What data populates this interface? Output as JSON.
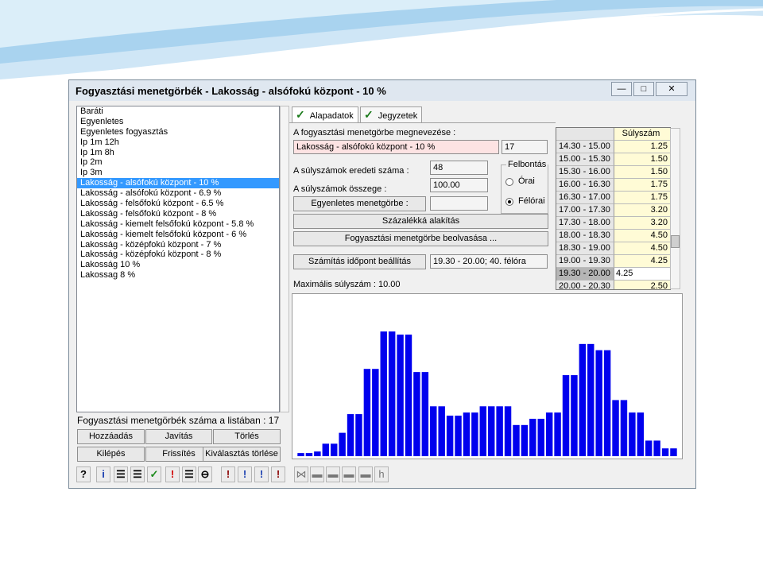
{
  "window": {
    "title": "Fogyasztási menetgörbék - Lakosság - alsófokú központ - 10 %",
    "minimize_glyph": "—",
    "maximize_glyph": "□",
    "close_glyph": "✕"
  },
  "list": {
    "items": [
      "Baráti",
      "Egyenletes",
      "Egyenletes fogyasztás",
      "Ip 1m 12h",
      "Ip 1m 8h",
      "Ip 2m",
      "Ip 3m",
      "Lakosság - alsófokú központ - 10 %",
      "Lakosság - alsófokú központ - 6.9 %",
      "Lakosság - felsőfokú központ - 6.5 %",
      "Lakosság - felsőfokú központ - 8 %",
      "Lakosság - kiemelt felsőfokú központ - 5.8 %",
      "Lakosság - kiemelt felsőfokú központ - 6 %",
      "Lakosság - középfokú központ - 7 %",
      "Lakosság - középfokú központ - 8 %",
      "Lakosság 10 %",
      "Lakossag 8 %"
    ],
    "selected_index": 7,
    "count_label": "Fogyasztási menetgörbék száma a listában : 17"
  },
  "buttons": {
    "add": "Hozzáadás",
    "edit": "Javítás",
    "delete": "Törlés",
    "exit": "Kilépés",
    "refresh": "Frissítés",
    "clear_selection": "Kiválasztás törlése",
    "uniform": "Egyenletes menetgörbe :",
    "percent": "Százalékká alakítás",
    "read": "Fogyasztási menetgörbe beolvasása ...",
    "calc_time": "Számítás időpont beállítás"
  },
  "tabs": [
    {
      "label": "Alapadatok",
      "check": "✓"
    },
    {
      "label": "Jegyzetek",
      "check": "✓"
    }
  ],
  "form": {
    "name_label": "A fogyasztási menetgörbe megnevezése :",
    "name_value": "Lakosság - alsófokú központ - 10 %",
    "name_id": "17",
    "orig_count_label": "A súlyszámok eredeti száma :",
    "orig_count_value": "48",
    "sum_label": "A súlyszámok összege :",
    "sum_value": "100.00",
    "uniform_value": "",
    "resolution_title": "Felbontás",
    "opt_hourly": "Órai",
    "opt_halfhourly": "Félórai",
    "calc_time_value": "19.30 - 20.00; 40. félóra",
    "max_label": "Maximális súlyszám : 10.00"
  },
  "grid": {
    "header": "Súlyszám",
    "rows": [
      {
        "time": "14.30 - 15.00",
        "value": "1.25"
      },
      {
        "time": "15.00 - 15.30",
        "value": "1.50"
      },
      {
        "time": "15.30 - 16.00",
        "value": "1.50"
      },
      {
        "time": "16.00 - 16.30",
        "value": "1.75"
      },
      {
        "time": "16.30 - 17.00",
        "value": "1.75"
      },
      {
        "time": "17.00 - 17.30",
        "value": "3.20"
      },
      {
        "time": "17.30 - 18.00",
        "value": "3.20"
      },
      {
        "time": "18.00 - 18.30",
        "value": "4.50"
      },
      {
        "time": "18.30 - 19.00",
        "value": "4.50"
      },
      {
        "time": "19.00 - 19.30",
        "value": "4.25"
      },
      {
        "time": "19.30 - 20.00",
        "value": "4.25"
      },
      {
        "time": "20.00 - 20.30",
        "value": "2.50"
      }
    ],
    "selected_index": 10
  },
  "toolbar_left": [
    "?",
    "i",
    "☰",
    "☰",
    "✓",
    "!",
    "☰",
    "⊖",
    "!",
    "!",
    "!",
    "!"
  ],
  "toolbar_right": [
    "⋈",
    "▬",
    "▬",
    "▬",
    "▬",
    "h"
  ],
  "chart_data": {
    "type": "bar",
    "color": "#0000ee",
    "values": [
      0.2,
      0.2,
      0.3,
      0.8,
      0.8,
      1.5,
      2.7,
      2.7,
      5.6,
      5.6,
      8.0,
      8.0,
      7.8,
      7.8,
      5.4,
      5.4,
      3.2,
      3.2,
      2.6,
      2.6,
      2.8,
      2.8,
      3.2,
      3.2,
      3.2,
      3.2,
      2.0,
      2.0,
      2.4,
      2.4,
      2.8,
      2.8,
      5.2,
      5.2,
      7.2,
      7.2,
      6.8,
      6.8,
      3.6,
      3.6,
      2.8,
      2.8,
      1.0,
      1.0,
      0.5,
      0.5
    ],
    "ylim": [
      0,
      10
    ],
    "grid": false
  }
}
